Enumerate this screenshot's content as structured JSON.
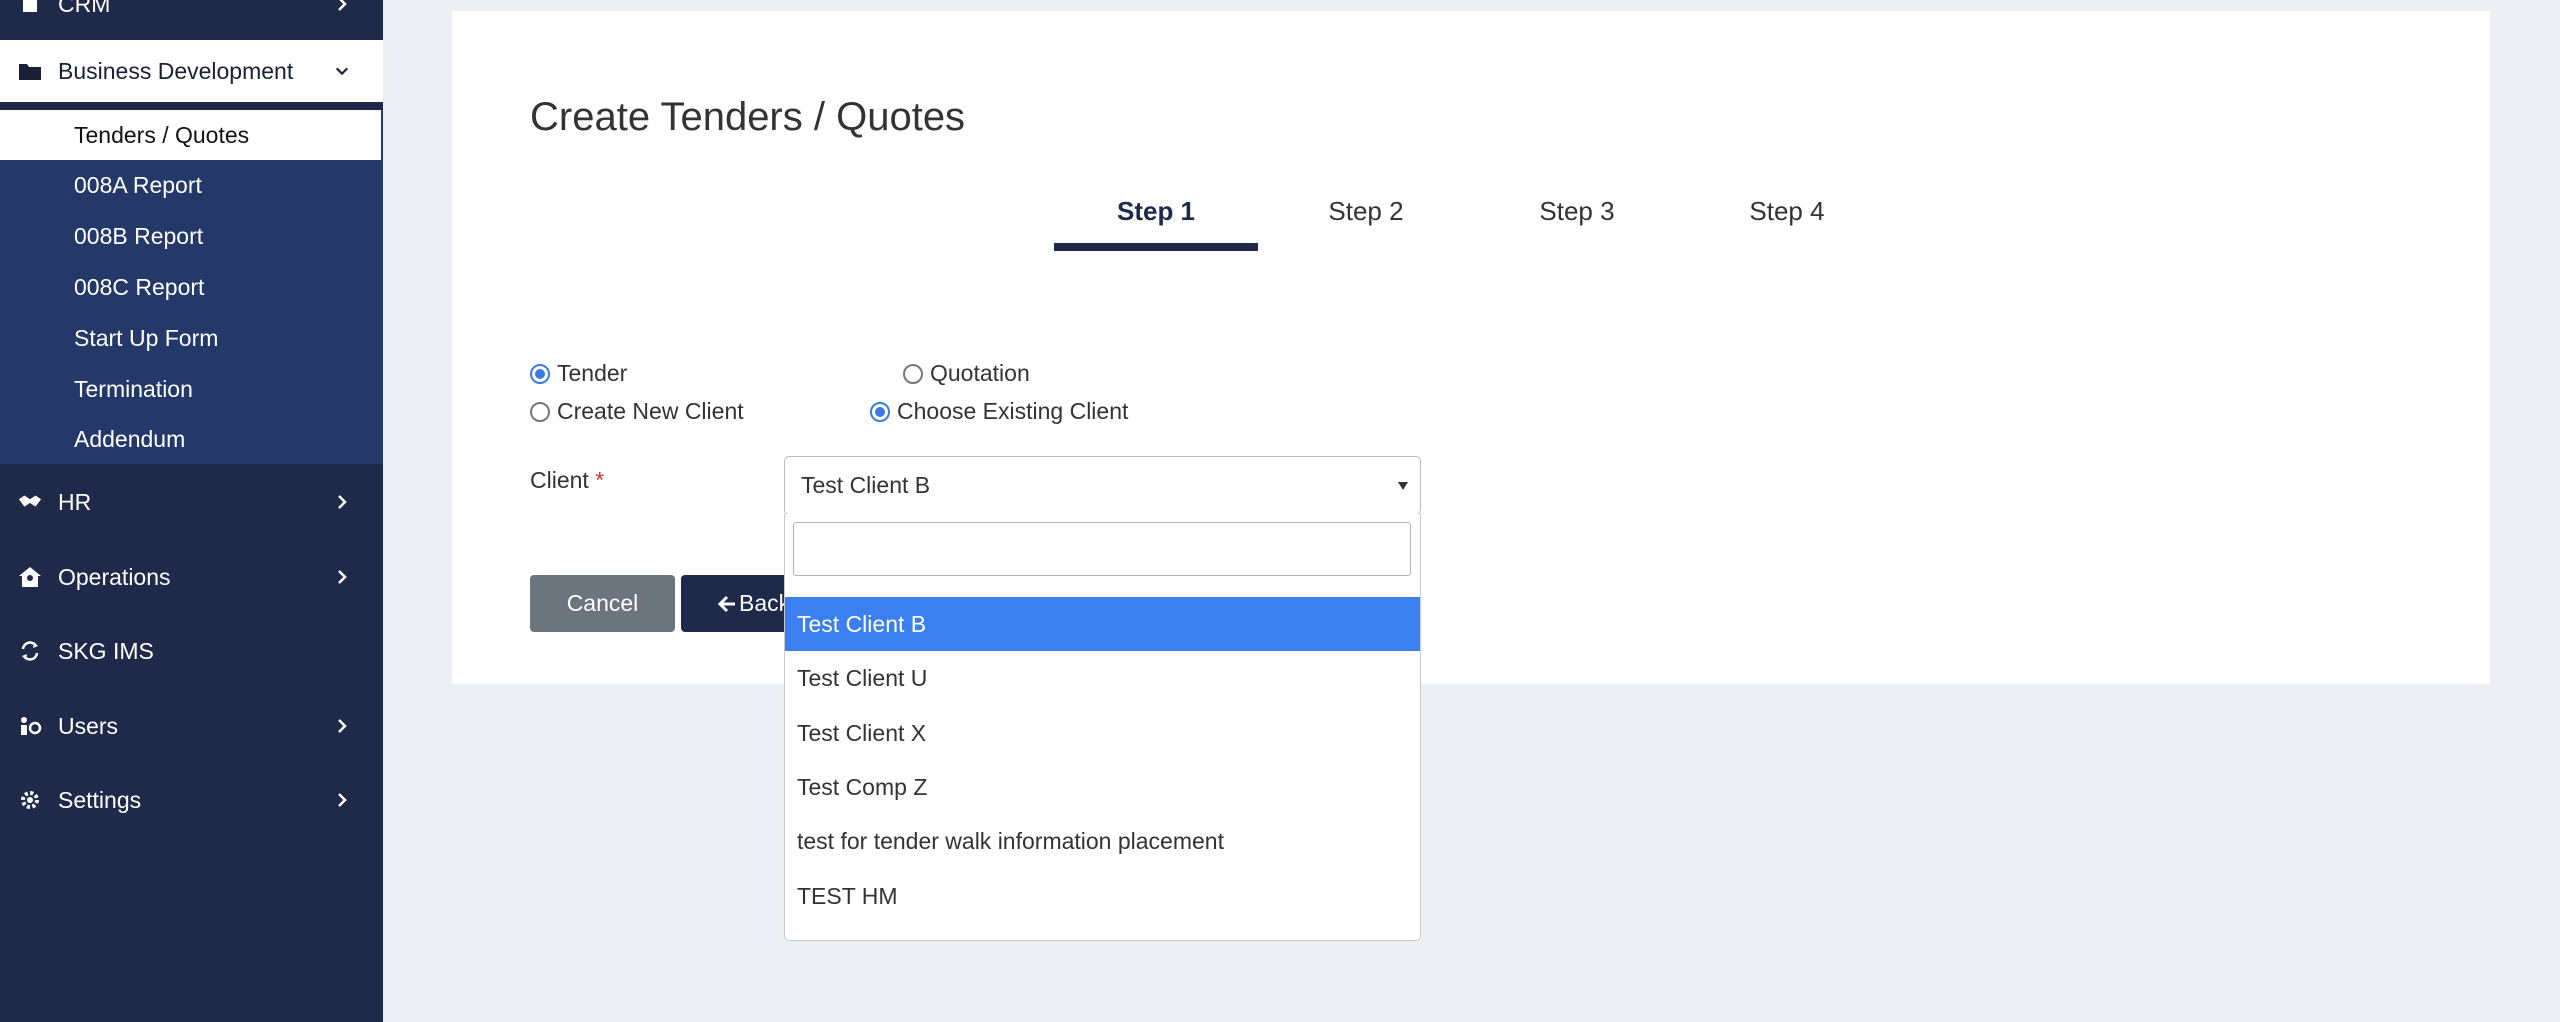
{
  "sidebar": {
    "crm_label": "CRM",
    "business_development": "Business Development",
    "sub_items": [
      "Tenders / Quotes",
      "008A Report",
      "008B Report",
      "008C Report",
      "Start Up Form",
      "Termination",
      "Addendum"
    ],
    "hr": "HR",
    "operations": "Operations",
    "skg_ims": "SKG IMS",
    "users": "Users",
    "settings": "Settings"
  },
  "main": {
    "title": "Create Tenders / Quotes",
    "steps": [
      "Step 1",
      "Step 2",
      "Step 3",
      "Step 4"
    ],
    "active_step": 1,
    "type_options": {
      "tender": "Tender",
      "quotation": "Quotation",
      "selected": "Tender"
    },
    "client_options": {
      "new": "Create New Client",
      "existing": "Choose Existing Client",
      "selected": "Choose Existing Client"
    },
    "client_label": "Client",
    "required_marker": "*",
    "client_value": "Test Client B",
    "search_placeholder": "",
    "cancel_label": "Cancel",
    "back_label": "Back"
  },
  "dropdown": {
    "options": [
      "Test Client B",
      "Test Client U",
      "Test Client X",
      "Test Comp Z",
      "test for tender walk information placement",
      "TEST HM"
    ],
    "selected": "Test Client B"
  },
  "colors": {
    "sidebar_bg": "#1f2a4a",
    "submenu_bg": "#25386a",
    "accent": "#3b7ff0",
    "required": "#d9302c"
  }
}
